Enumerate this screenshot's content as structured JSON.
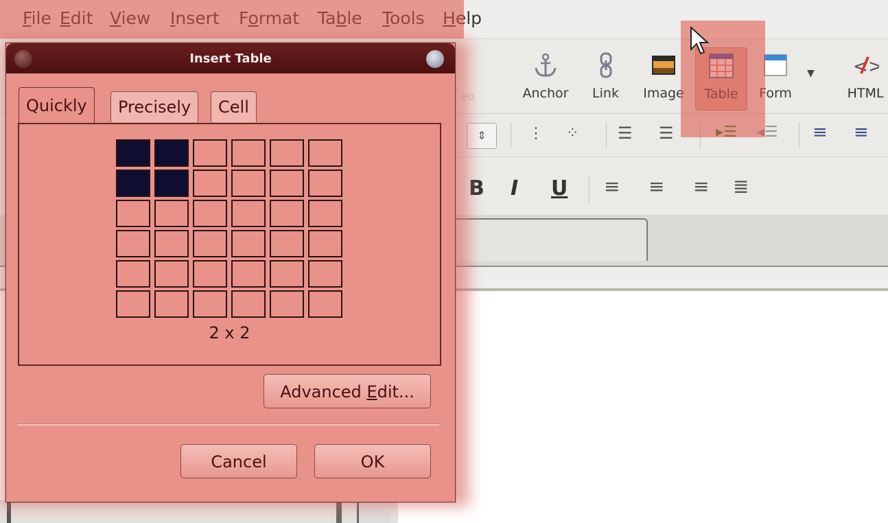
{
  "menubar": {
    "items": [
      {
        "label_pre": "",
        "label_ul": "F",
        "label_post": "ile"
      },
      {
        "label_pre": "",
        "label_ul": "E",
        "label_post": "dit"
      },
      {
        "label_pre": "",
        "label_ul": "V",
        "label_post": "iew"
      },
      {
        "label_pre": "",
        "label_ul": "I",
        "label_post": "nsert"
      },
      {
        "label_pre": "F",
        "label_ul": "o",
        "label_post": "rmat"
      },
      {
        "label_pre": "Ta",
        "label_ul": "b",
        "label_post": "le"
      },
      {
        "label_pre": "",
        "label_ul": "T",
        "label_post": "ools"
      },
      {
        "label_pre": "",
        "label_ul": "H",
        "label_post": "elp"
      }
    ]
  },
  "toolbar": {
    "buttons": [
      {
        "label": "Anchor",
        "icon": "anchor-icon"
      },
      {
        "label": "Link",
        "icon": "link-icon"
      },
      {
        "label": "Image",
        "icon": "image-icon"
      },
      {
        "label": "Table",
        "icon": "table-icon"
      },
      {
        "label": "Form",
        "icon": "form-icon"
      },
      {
        "label": "HTML",
        "icon": "html-icon"
      }
    ],
    "partial_label": "eo"
  },
  "format": {
    "bold": "B",
    "italic": "I",
    "underline": "U"
  },
  "dialog": {
    "title": "Insert Table",
    "tabs": [
      "Quickly",
      "Precisely",
      "Cell"
    ],
    "active_tab": "Quickly",
    "grid": {
      "rows": 6,
      "cols": 6,
      "selected_rows": 2,
      "selected_cols": 2
    },
    "size_label": "2 x 2",
    "advanced_pre": "Advanced ",
    "advanced_ul": "E",
    "advanced_post": "dit...",
    "cancel_label": "Cancel",
    "ok_label": "OK"
  },
  "colors": {
    "highlight": "#dc5046",
    "grid_selected": "#0e0e30",
    "titlebar": "#5a1515"
  }
}
